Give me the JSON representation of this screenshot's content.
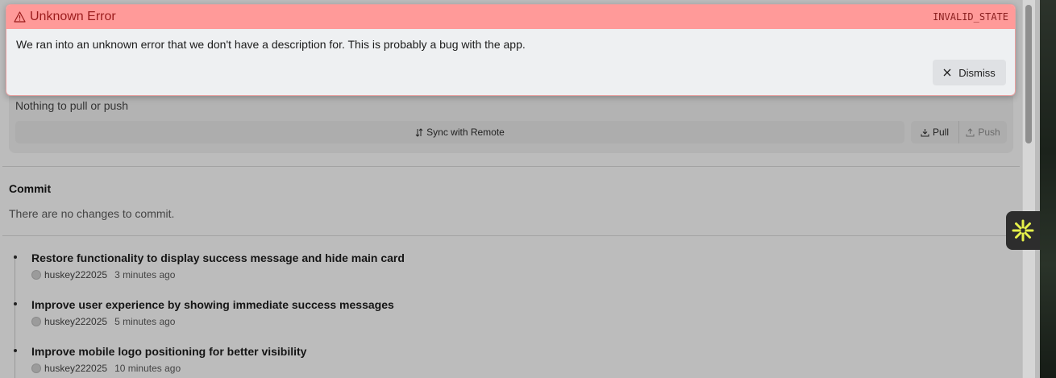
{
  "error": {
    "title": "Unknown Error",
    "code": "INVALID_STATE",
    "message": "We ran into an unknown error that we don't have a description for. This is probably a bug with the app.",
    "dismiss_label": "Dismiss",
    "colors": {
      "header": "#ff9a99",
      "title": "#9b1c1c"
    }
  },
  "sync": {
    "status": "Nothing to pull or push",
    "sync_label": "Sync with Remote",
    "pull_label": "Pull",
    "push_label": "Push"
  },
  "commit": {
    "title": "Commit",
    "empty_message": "There are no changes to commit."
  },
  "log": [
    {
      "message": "Restore functionality to display success message and hide main card",
      "author": "huskey222025",
      "time": "3 minutes ago"
    },
    {
      "message": "Improve user experience by showing immediate success messages",
      "author": "huskey222025",
      "time": "5 minutes ago"
    },
    {
      "message": "Improve mobile logo positioning for better visibility",
      "author": "huskey222025",
      "time": "10 minutes ago"
    }
  ],
  "icons": {
    "error": "warning-triangle-icon",
    "sync": "sort-arrows-icon",
    "pull": "download-icon",
    "push": "upload-icon",
    "dismiss": "close-icon",
    "extension": "sparkle-icon"
  },
  "extension_color": "#e6f14a"
}
